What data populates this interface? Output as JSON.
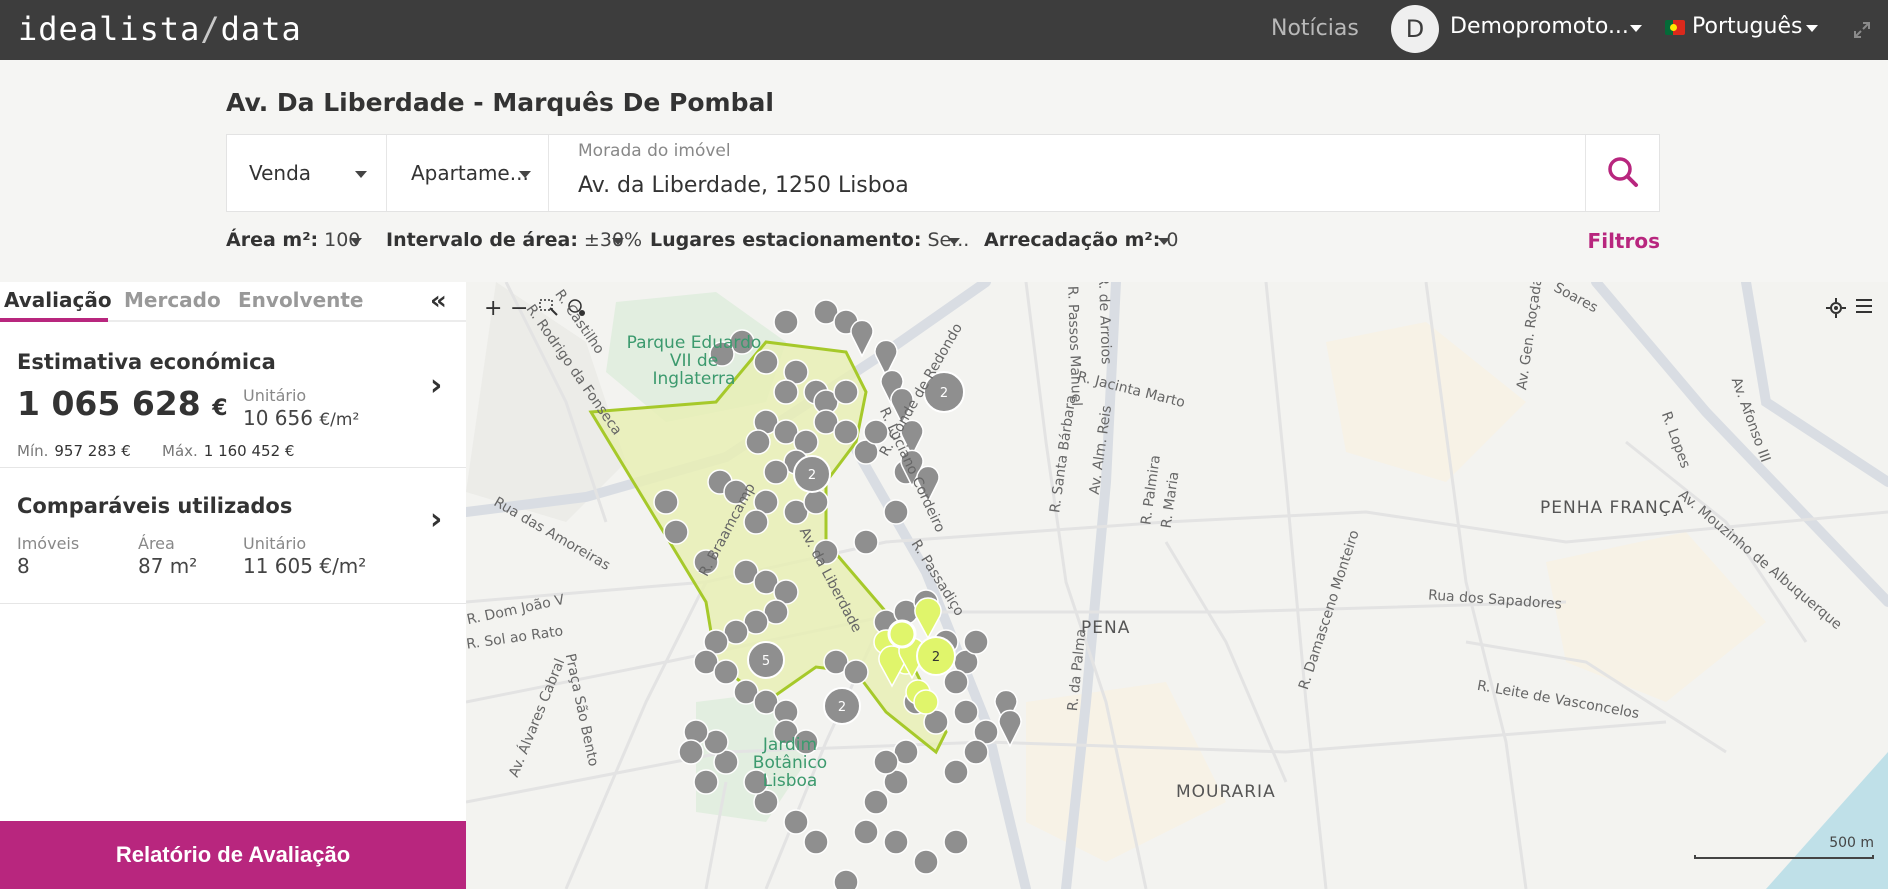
{
  "topbar": {
    "logo_main": "idealista",
    "logo_slash": "/",
    "logo_data": "data",
    "news": "Notícias",
    "avatar_initial": "D",
    "user_name": "Demopromoto...",
    "language": "Português"
  },
  "header": {
    "title": "Av. Da Liberdade - Marquês De Pombal",
    "operation": "Venda",
    "property_type": "Apartame...",
    "address_label": "Morada do imóvel",
    "address_value": "Av. da Liberdade, 1250 Lisboa"
  },
  "filters": {
    "area_label": "Área m²:",
    "area_value": "100",
    "interval_label": "Intervalo de área:",
    "interval_value": "±30%",
    "parking_label": "Lugares estacionamento:",
    "parking_value": "Se...",
    "storage_label": "Arrecadação m²:",
    "storage_value": "0",
    "filters_link": "Filtros"
  },
  "tabs": [
    "Avaliação",
    "Mercado",
    "Envolvente"
  ],
  "estimate": {
    "title": "Estimativa económica",
    "value": "1 065 628",
    "currency": "€",
    "unit_label": "Unitário",
    "unit_value": "10 656",
    "unit_suffix": "€/m²",
    "min_label": "Mín.",
    "min_value": "957 283 €",
    "max_label": "Máx.",
    "max_value": "1 160 452 €"
  },
  "comparables": {
    "title": "Comparáveis utilizados",
    "count_label": "Imóveis",
    "count_value": "8",
    "area_label": "Área",
    "area_value": "87 m²",
    "unit_label": "Unitário",
    "unit_value": "11 605 €/m²"
  },
  "report_button": "Relatório de Avaliação",
  "map": {
    "areas": [
      "PENHA FRANÇA",
      "PENA",
      "MOURARIA"
    ],
    "parks": [
      "Parque Eduardo VII de Inglaterra",
      "Jardim Botânico Lisboa"
    ],
    "streets": [
      "R. Rodrigo da Fonseca",
      "R. Castilho",
      "R. Braamcamp",
      "Rua das Amoreiras",
      "R. Dom João V",
      "R. Sol ao Rato",
      "Av. Álvares Cabral",
      "Praça São Bento",
      "R. Jacinta Marto",
      "R. Luciano Cordeiro",
      "R. Passos Manuel",
      "R. Santa Bárbara",
      "Av. Alm. Reis",
      "R. Palmira",
      "R. Maria",
      "Rua dos Sapadores",
      "R. Damasceno Monteiro",
      "R. da Palma",
      "R. Leite de Vasconcelos",
      "Av. Mouzinho de Albuquerque",
      "Av. Afonso III",
      "R. Lopes",
      "Soares",
      "Av. da Liberdade",
      "R. Passadiço",
      "R. Conde de Redondo",
      "Av. Gen. Roçadas",
      "R. de Arroios"
    ],
    "cluster_counts": [
      "2",
      "2",
      "5",
      "2",
      "2"
    ],
    "scale": "500 m",
    "colors": {
      "polygon_fill": "#e7efb5",
      "polygon_stroke": "#a6c92a",
      "comparable": "#e0f56b",
      "marker": "#8f8f8f"
    }
  }
}
